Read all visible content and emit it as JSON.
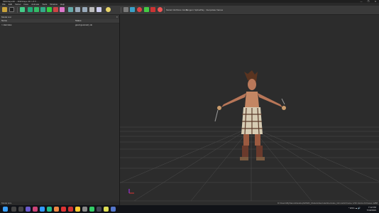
{
  "window": {
    "title": "Milkshape3D – MilkShape 3D 1.8.5 - ...",
    "controls": [
      "—",
      "❐",
      "✕"
    ]
  },
  "menu": [
    "File",
    "Edit",
    "Vertex",
    "Face",
    "Animate",
    "Tools",
    "Window",
    "Help"
  ],
  "toolbar": {
    "labels": [
      "Model Info",
      "Show Joints",
      "Tangent",
      "Spline",
      "Play",
      "Interpolate frames"
    ],
    "icons": [
      "folder-icon",
      "save-icon",
      "move-icon",
      "box-icon",
      "sphere-icon",
      "joint-icon",
      "material-icon",
      "cursor-icon",
      "scale-icon",
      "rotate-icon",
      "light-icon",
      "camera-icon",
      "grid-icon",
      "record-icon",
      "keyframe-icon",
      "ik-icon"
    ]
  },
  "left_panel": {
    "header": "Model List",
    "columns": [
      "Name",
      "Status"
    ],
    "rows": [
      {
        "name": "> Hercules",
        "status": "good geometry ok"
      }
    ],
    "status": "Model size"
  },
  "viewport": {
    "status": "D:\\Users\\MyName\\Desktop\\MS3D_Models\\Hercules\\hercules_full.ms3d   Frame 1/30   Joints 24   Faces 1288"
  },
  "taskbar": {
    "time": "7:12 PM",
    "date": "7/19/2023",
    "tray": "^ ENG ☁ 🔊"
  },
  "colors": {
    "accent": "#2e7df6",
    "grid": "#5a5a5a",
    "toolbar_bg": "#3a3a3a"
  }
}
